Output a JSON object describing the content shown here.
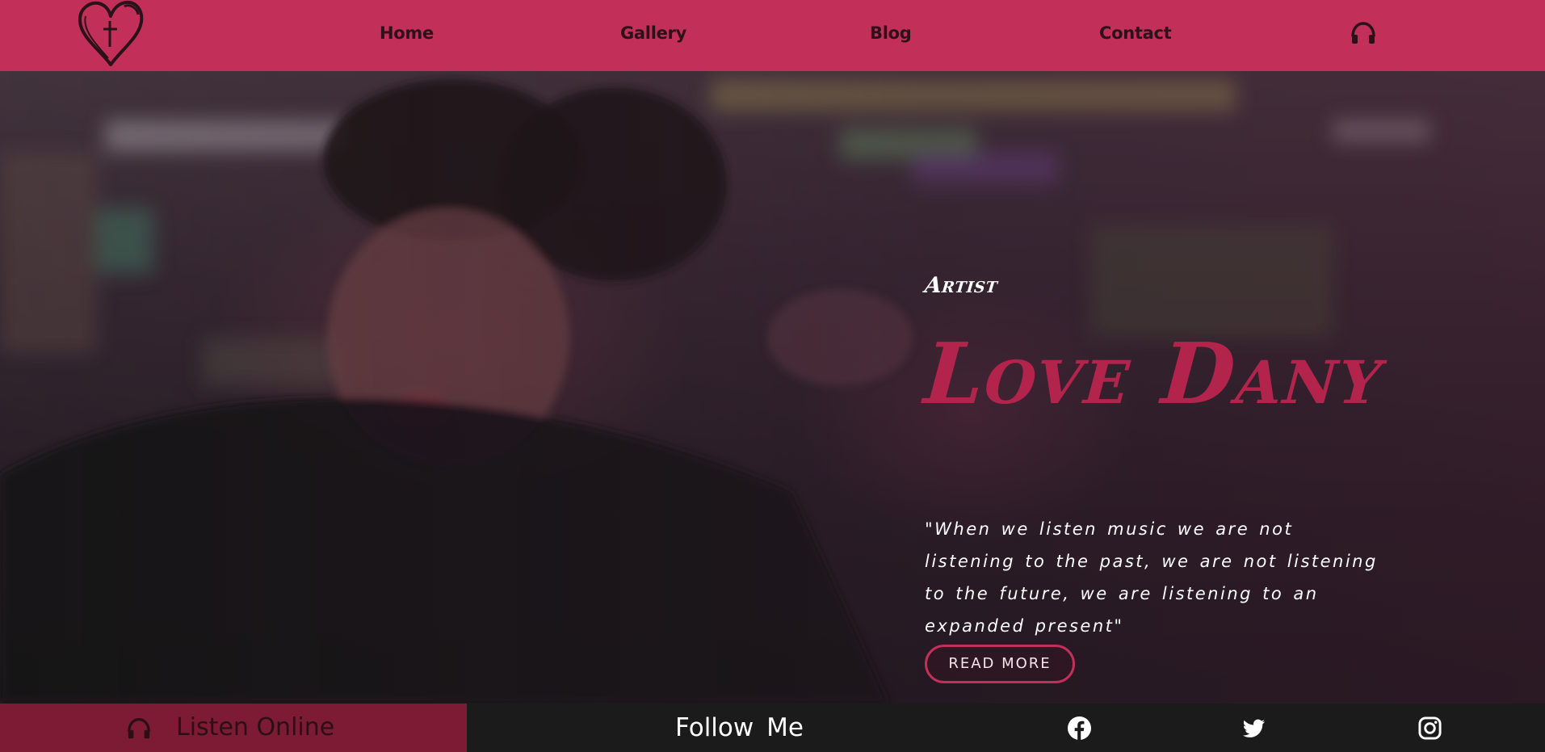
{
  "colors": {
    "brand_pink": "#c2305a",
    "title_crimson": "#b3244d",
    "listen_bar": "#7c1b33",
    "footer_bg": "#1b1b1b"
  },
  "navbar": {
    "logo_icon": "heart-cross-logo",
    "links": [
      {
        "label": "Home"
      },
      {
        "label": "Gallery"
      },
      {
        "label": "Blog"
      },
      {
        "label": "Contact"
      }
    ],
    "headphones_icon": "headphones-icon"
  },
  "hero": {
    "background": "blurred photo of the artist",
    "subtitle": "Artist",
    "title": "Love Dany",
    "quote": "\"When we listen music we are not listening to the past, we are not listening to the future, we are listening to an expanded present\"",
    "button_label": "READ MORE"
  },
  "bottom_bar": {
    "listen_icon": "headphones-icon",
    "listen_label": "Listen Online",
    "follow_label": "Follow Me",
    "social_icons": [
      "facebook-icon",
      "twitter-icon",
      "instagram-icon"
    ]
  }
}
